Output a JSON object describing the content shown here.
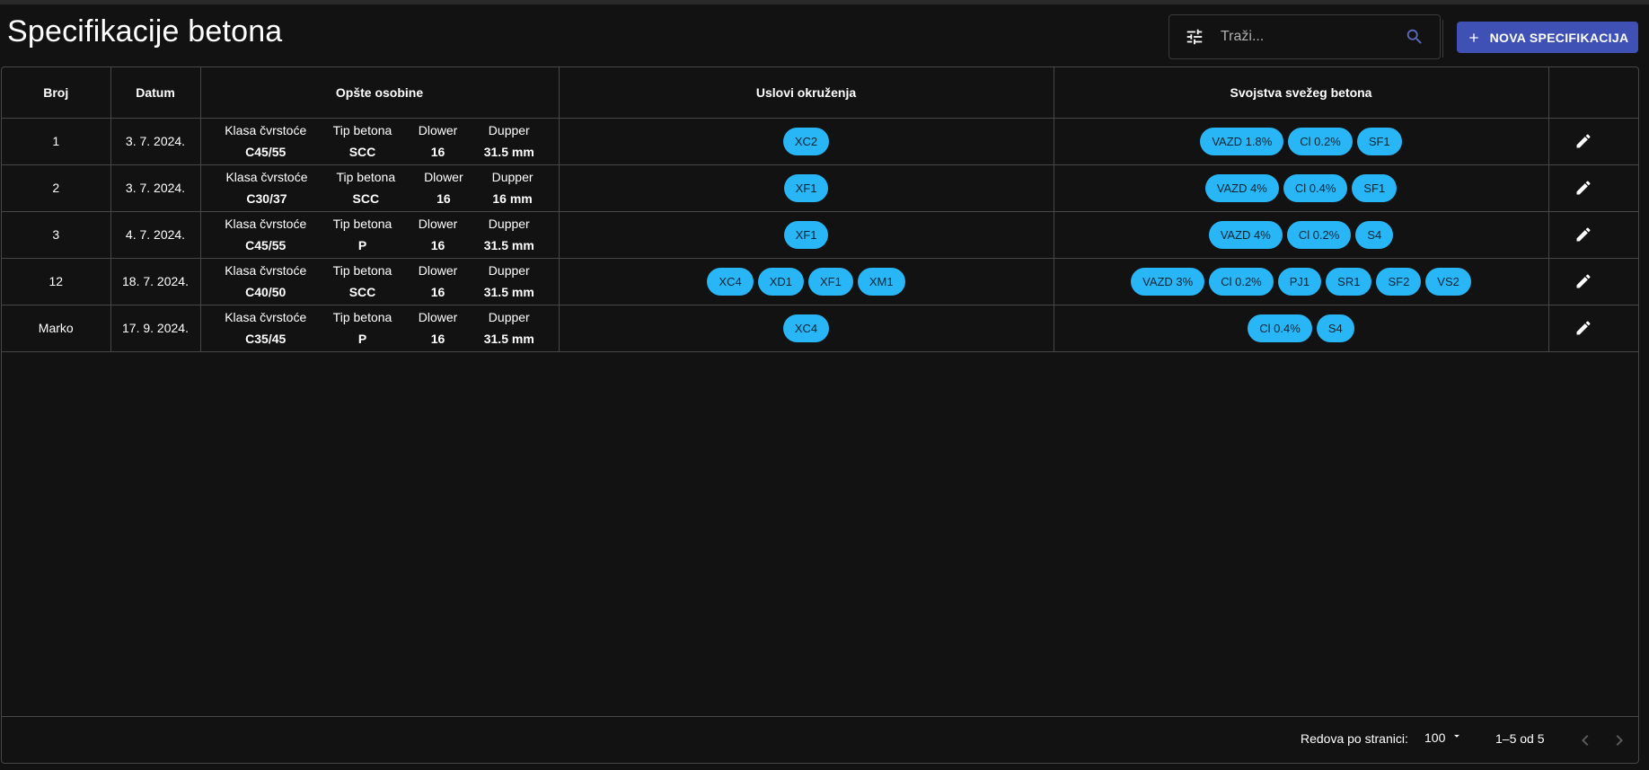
{
  "page": {
    "title": "Specifikacije betona"
  },
  "search": {
    "placeholder": "Traži...",
    "value": ""
  },
  "toolbar": {
    "new_label": "NOVA SPECIFIKACIJA",
    "accent_color": "#3f51b5"
  },
  "table": {
    "columns": [
      "Broj",
      "Datum",
      "Opšte osobine",
      "Uslovi okruženja",
      "Svojstva svežeg betona"
    ],
    "prop_labels": [
      "Klasa čvrstoće",
      "Tip betona",
      "Dlower",
      "Dupper"
    ],
    "chip_color": "#29b6f6",
    "rows": [
      {
        "broj": "1",
        "datum": "3. 7. 2024.",
        "klasa": "C45/55",
        "tip": "SCC",
        "dlower": "16",
        "dupper": "31.5 mm",
        "uslovi": [
          "XC2"
        ],
        "svojstva": [
          "VAZD 1.8%",
          "Cl 0.2%",
          "SF1"
        ]
      },
      {
        "broj": "2",
        "datum": "3. 7. 2024.",
        "klasa": "C30/37",
        "tip": "SCC",
        "dlower": "16",
        "dupper": "16 mm",
        "uslovi": [
          "XF1"
        ],
        "svojstva": [
          "VAZD 4%",
          "Cl 0.4%",
          "SF1"
        ]
      },
      {
        "broj": "3",
        "datum": "4. 7. 2024.",
        "klasa": "C45/55",
        "tip": "P",
        "dlower": "16",
        "dupper": "31.5 mm",
        "uslovi": [
          "XF1"
        ],
        "svojstva": [
          "VAZD 4%",
          "Cl 0.2%",
          "S4"
        ]
      },
      {
        "broj": "12",
        "datum": "18. 7. 2024.",
        "klasa": "C40/50",
        "tip": "SCC",
        "dlower": "16",
        "dupper": "31.5 mm",
        "uslovi": [
          "XC4",
          "XD1",
          "XF1",
          "XM1"
        ],
        "svojstva": [
          "VAZD 3%",
          "Cl 0.2%",
          "PJ1",
          "SR1",
          "SF2",
          "VS2"
        ]
      },
      {
        "broj": "Marko",
        "datum": "17. 9. 2024.",
        "klasa": "C35/45",
        "tip": "P",
        "dlower": "16",
        "dupper": "31.5 mm",
        "uslovi": [
          "XC4"
        ],
        "svojstva": [
          "Cl 0.4%",
          "S4"
        ]
      }
    ]
  },
  "pagination": {
    "rows_label": "Redova po stranici:",
    "rows_value": "100",
    "range": "1–5 od 5"
  },
  "icons": {
    "filter": "tune-icon",
    "search": "search-icon",
    "add": "plus-icon",
    "edit": "pencil-icon",
    "prev": "chevron-left-icon",
    "next": "chevron-right-icon",
    "dropdown": "caret-down-icon"
  }
}
